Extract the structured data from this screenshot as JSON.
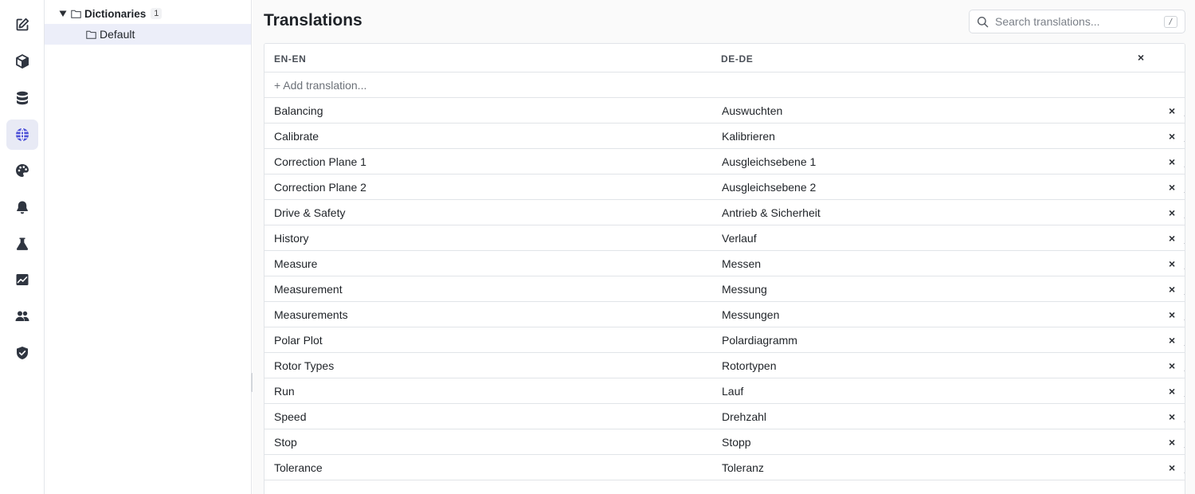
{
  "rail": {
    "items": [
      {
        "icon": "edit-icon",
        "active": false
      },
      {
        "icon": "cube-icon",
        "active": false
      },
      {
        "icon": "database-icon",
        "active": false
      },
      {
        "icon": "globe-icon",
        "active": true
      },
      {
        "icon": "palette-icon",
        "active": false
      },
      {
        "icon": "bell-icon",
        "active": false
      },
      {
        "icon": "flask-icon",
        "active": false
      },
      {
        "icon": "chart-icon",
        "active": false
      },
      {
        "icon": "users-icon",
        "active": false
      },
      {
        "icon": "shield-icon",
        "active": false
      }
    ],
    "accent_color": "#4b4fd6"
  },
  "tree": {
    "root": {
      "label": "Dictionaries",
      "count": "1",
      "expanded": true
    },
    "children": [
      {
        "label": "Default",
        "selected": true
      }
    ]
  },
  "main": {
    "title": "Translations",
    "search": {
      "placeholder": "Search translations...",
      "value": "",
      "shortcut": "/"
    },
    "table": {
      "columns": [
        "EN-EN",
        "DE-DE"
      ],
      "close_symbol": "×",
      "add_label": "+ Add translation...",
      "delete_symbol": "×",
      "rows": [
        {
          "en": "Balancing",
          "de": "Auswuchten"
        },
        {
          "en": "Calibrate",
          "de": "Kalibrieren"
        },
        {
          "en": "Correction Plane 1",
          "de": "Ausgleichsebene 1"
        },
        {
          "en": "Correction Plane 2",
          "de": "Ausgleichsebene 2"
        },
        {
          "en": "Drive & Safety",
          "de": "Antrieb & Sicherheit"
        },
        {
          "en": "History",
          "de": "Verlauf"
        },
        {
          "en": "Measure",
          "de": "Messen"
        },
        {
          "en": "Measurement",
          "de": "Messung"
        },
        {
          "en": "Measurements",
          "de": "Messungen"
        },
        {
          "en": "Polar Plot",
          "de": "Polardiagramm"
        },
        {
          "en": "Rotor Types",
          "de": "Rotortypen"
        },
        {
          "en": "Run",
          "de": "Lauf"
        },
        {
          "en": "Speed",
          "de": "Drehzahl"
        },
        {
          "en": "Stop",
          "de": "Stopp"
        },
        {
          "en": "Tolerance",
          "de": "Toleranz"
        }
      ]
    }
  }
}
